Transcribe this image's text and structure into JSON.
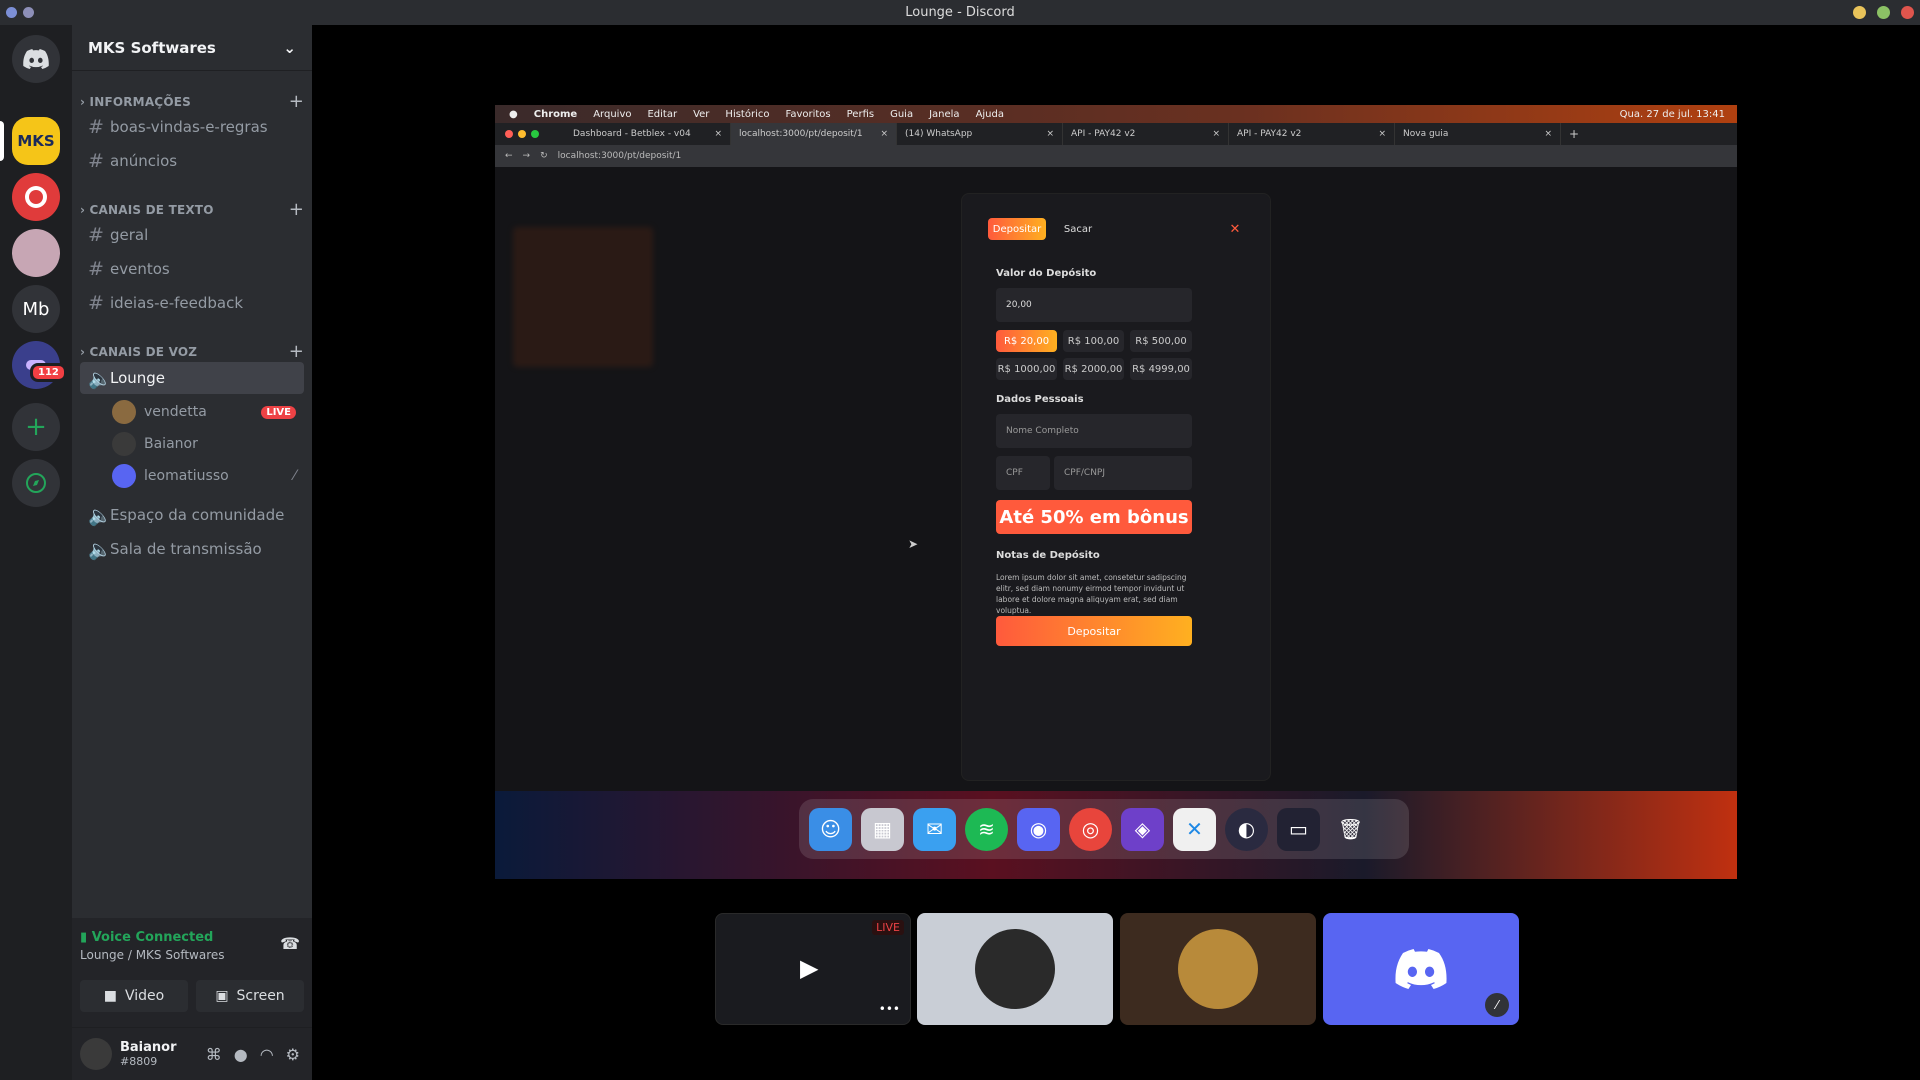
{
  "window": {
    "title": "Lounge - Discord"
  },
  "server": {
    "name": "MKS Softwares",
    "rail_badge": "112",
    "mb_label": "Mb"
  },
  "categories": {
    "info": "INFORMAÇÕES",
    "text": "CANAIS DE TEXTO",
    "voice": "CANAIS DE VOZ"
  },
  "channels": {
    "info": [
      "boas-vindas-e-regras",
      "anúncios"
    ],
    "text": [
      "geral",
      "eventos",
      "ideias-e-feedback"
    ],
    "voice_active": "Lounge",
    "voice_users": [
      {
        "name": "vendetta",
        "live": "LIVE"
      },
      {
        "name": "Baianor"
      },
      {
        "name": "leomatiusso"
      }
    ],
    "voice_other": [
      "Espaço da comunidade",
      "Sala de transmissão"
    ]
  },
  "voice_panel": {
    "status": "Voice Connected",
    "location": "Lounge / MKS Softwares",
    "video_label": "Video",
    "screen_label": "Screen"
  },
  "user": {
    "name": "Baianor",
    "tag": "#8809"
  },
  "stream": {
    "mac_menu": [
      "Chrome",
      "Arquivo",
      "Editar",
      "Ver",
      "Histórico",
      "Favoritos",
      "Perfis",
      "Guia",
      "Janela",
      "Ajuda"
    ],
    "mac_clock": "Qua. 27 de jul.  13:41",
    "tabs": [
      "Dashboard - Betblex - v04",
      "localhost:3000/pt/deposit/1",
      "(14) WhatsApp",
      "API - PAY42 v2",
      "API - PAY42 v2",
      "Nova guia"
    ],
    "url": "localhost:3000/pt/deposit/1",
    "modal": {
      "tab_deposit": "Depositar",
      "tab_withdraw": "Sacar",
      "close": "✕",
      "amount_label": "Valor do Depósito",
      "amount_value": "20,00",
      "presets": [
        "R$ 20,00",
        "R$ 100,00",
        "R$ 500,00",
        "R$ 1000,00",
        "R$ 2000,00",
        "R$ 4999,00"
      ],
      "personal_label": "Dados Pessoais",
      "name_placeholder": "Nome Completo",
      "doc_type": "CPF",
      "doc_placeholder": "CPF/CNPJ",
      "bonus": "Até 50% em bônus",
      "notes_label": "Notas de Depósito",
      "notes_text": "Lorem ipsum dolor sit amet, consetetur sadipscing elitr, sed diam nonumy eirmod tempor invidunt ut labore et dolore magna aliquyam erat, sed diam voluptua.",
      "submit": "Depositar"
    }
  },
  "tiles": {
    "live_label": "LIVE",
    "more": "•••"
  },
  "colors": {
    "accent": "#5865f2",
    "live": "#ed4245",
    "connected": "#23a55a",
    "brand_gradient_start": "#ff5a3c",
    "brand_gradient_end": "#ffb020"
  }
}
